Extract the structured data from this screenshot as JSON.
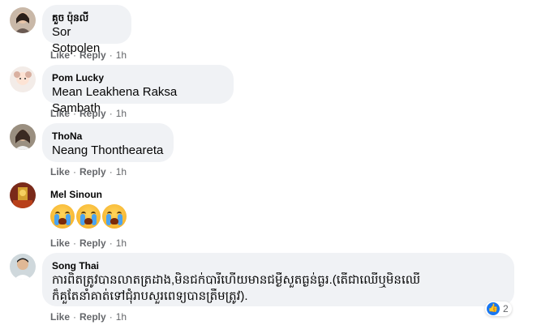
{
  "comments": [
    {
      "name": "គួច ប៉ុនលី",
      "text": "Sor Sotpolen",
      "like": "Like",
      "reply": "Reply",
      "time": "1h",
      "avatar": "female-avatar"
    },
    {
      "name": "Pom Lucky",
      "text": "Mean Leakhena Raksa Sambath",
      "like": "Like",
      "reply": "Reply",
      "time": "1h",
      "avatar": "cartoon-avatar"
    },
    {
      "name": "ThoNa",
      "text": "Neang Thontheareta",
      "like": "Like",
      "reply": "Reply",
      "time": "1h",
      "avatar": "female-avatar"
    },
    {
      "name": "Mel Sinoun",
      "text": "",
      "emoji": "crying-face",
      "like": "Like",
      "reply": "Reply",
      "time": "1h",
      "avatar": "shrine-avatar"
    },
    {
      "name": "Song Thai",
      "text_line1": "ការពិតត្រូវបានលាតត្រដាង,មិនជក់បារីហើយមានជម្ងឺសួតធ្ងន់ធ្ងរ.(តើជាឈើឬមិនឈើ",
      "text_line2": "ក៏គួតែនាំគាត់ទៅជុំរាបសួរពេទ្យបានត្រឹមត្រូវ).",
      "like": "Like",
      "reply": "Reply",
      "time": "1h",
      "avatar": "male-avatar",
      "reaction_count": "2"
    }
  ],
  "colors": {
    "bubble": "#f0f2f5",
    "meta": "#65676b",
    "like_blue": "#1877f2"
  }
}
